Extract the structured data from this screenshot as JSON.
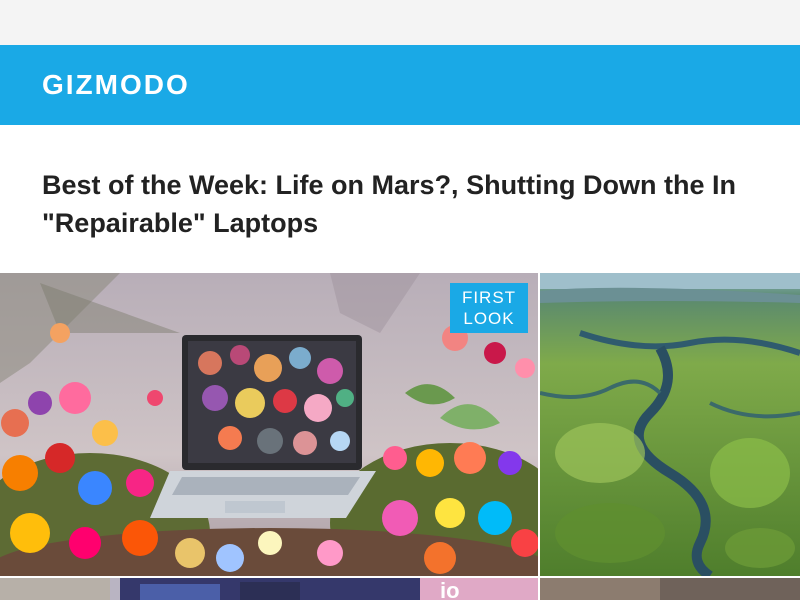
{
  "site": {
    "logo": "GIZMODO"
  },
  "article": {
    "title_line1": "Best of the Week: Life on Mars?, Shutting Down the In",
    "title_line2": "\"Repairable\" Laptops"
  },
  "tiles": [
    {
      "name": "laptop-flowers-image",
      "badge_line1": "FIRST",
      "badge_line2": "LOOK"
    },
    {
      "name": "aerial-river-delta-image"
    },
    {
      "name": "bottom-left-image",
      "badge_text": "io"
    },
    {
      "name": "bottom-right-image"
    }
  ],
  "colors": {
    "brand": "#1aa9e6",
    "title": "#222222"
  }
}
